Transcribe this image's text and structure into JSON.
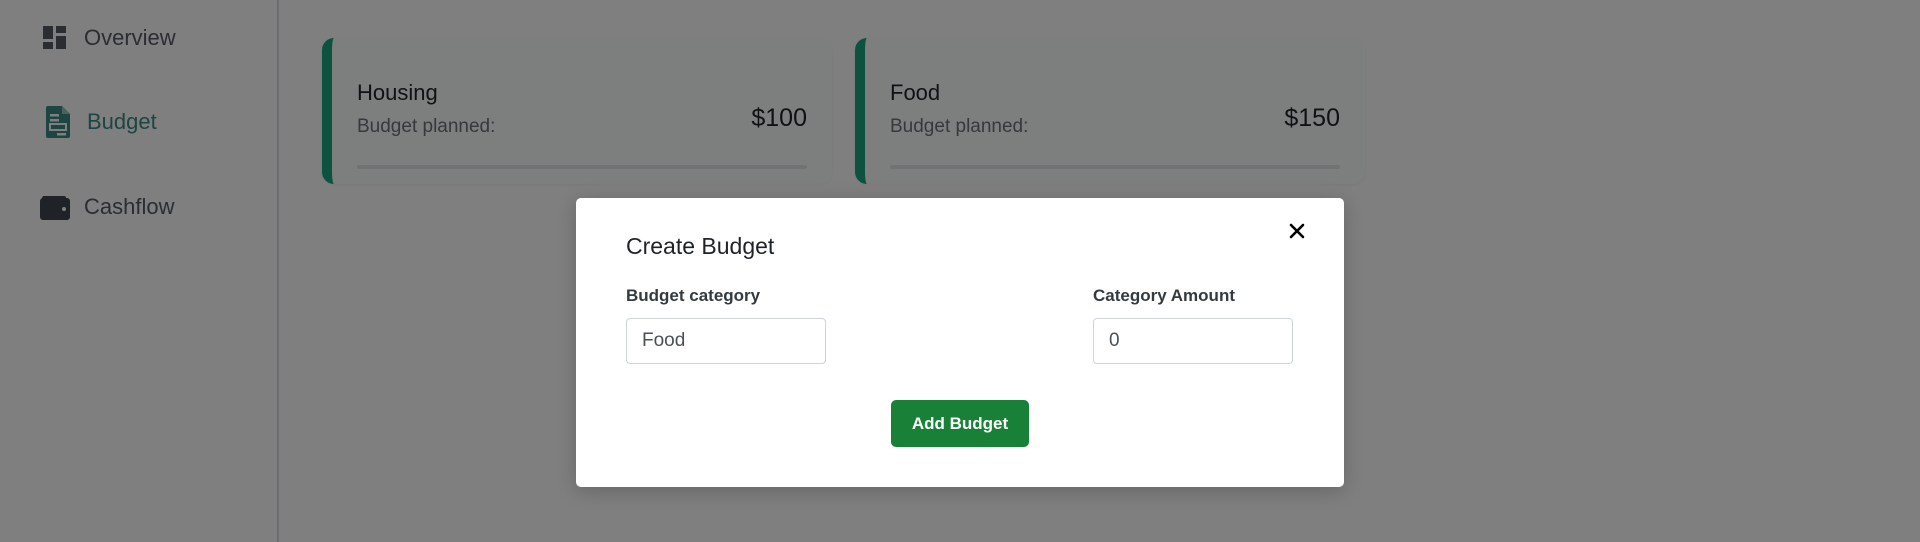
{
  "sidebar": {
    "items": [
      {
        "label": "Overview",
        "icon": "dashboard-icon",
        "active": false
      },
      {
        "label": "Budget",
        "icon": "document-icon",
        "active": true
      },
      {
        "label": "Cashflow",
        "icon": "wallet-icon",
        "active": false
      }
    ]
  },
  "cards": [
    {
      "title": "Housing",
      "subtitle": "Budget planned:",
      "amount": "$100"
    },
    {
      "title": "Food",
      "subtitle": "Budget planned:",
      "amount": "$150"
    }
  ],
  "modal": {
    "title": "Create Budget",
    "close_icon": "close-icon",
    "category_label": "Budget category",
    "category_value": "Food",
    "amount_label": "Category Amount",
    "amount_value": "0",
    "submit_label": "Add Budget"
  },
  "colors": {
    "accent": "#1aa37f",
    "active_nav": "#3a8a84",
    "button": "#198038",
    "overlay": "rgba(0,0,0,0.5)"
  }
}
